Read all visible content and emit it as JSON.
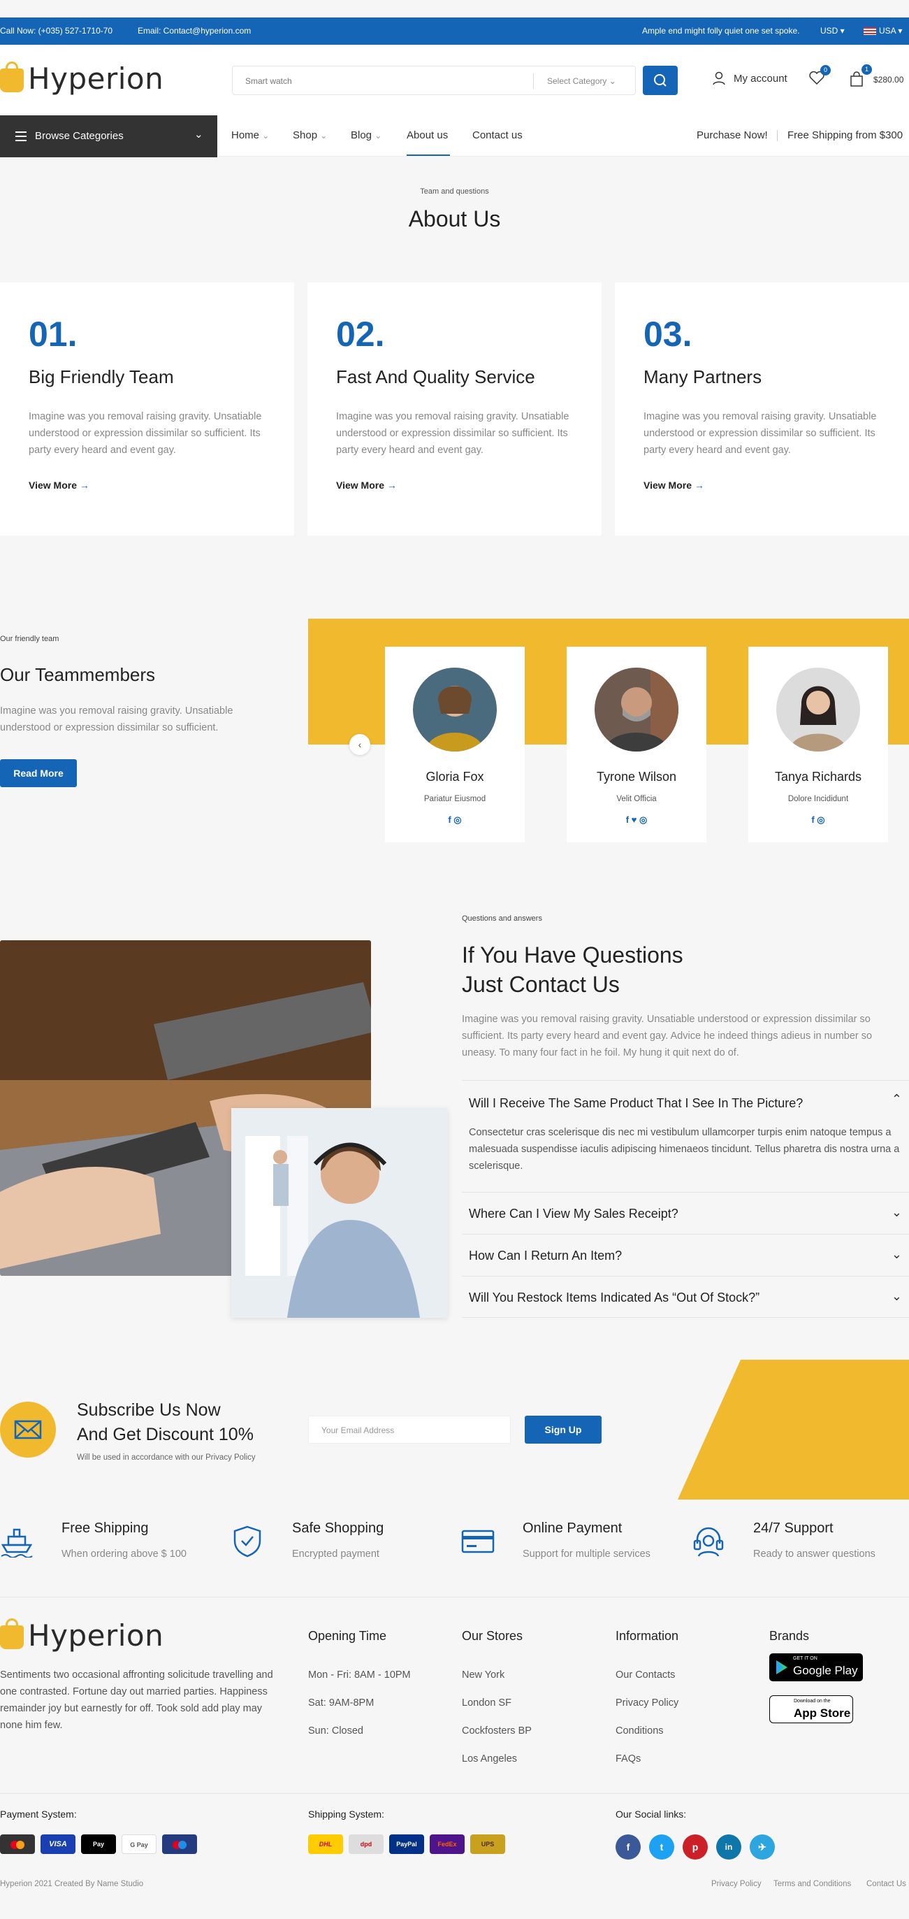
{
  "topbar": {
    "phone": "Call Now: (+035) 527-1710-70",
    "email": "Email: Contact@hyperion.com",
    "promo": "Ample end might folly quiet one set spoke.",
    "currency": "USD",
    "country": "USA"
  },
  "header": {
    "logo": "Hyperion",
    "search_placeholder": "Smart watch",
    "category": "Select Category",
    "account": "My account",
    "wishlist_count": "0",
    "cart_count": "1",
    "cart_total": "$280.00"
  },
  "nav": {
    "browse": "Browse Categories",
    "items": [
      "Home",
      "Shop",
      "Blog",
      "About us",
      "Contact us"
    ],
    "purchase": "Purchase Now!",
    "shipping": "Free Shipping from $300"
  },
  "about": {
    "kicker": "Team and questions",
    "title": "About Us"
  },
  "cards": [
    {
      "num": "01.",
      "title": "Big Friendly Team",
      "desc": "Imagine was you removal raising gravity. Unsatiable understood or expression dissimilar so sufficient. Its party every heard and event gay.",
      "link": "View More"
    },
    {
      "num": "02.",
      "title": "Fast And Quality Service",
      "desc": "Imagine was you removal raising gravity. Unsatiable understood or expression dissimilar so sufficient. Its party every heard and event gay.",
      "link": "View More"
    },
    {
      "num": "03.",
      "title": "Many Partners",
      "desc": "Imagine was you removal raising gravity. Unsatiable understood or expression dissimilar so sufficient. Its party every heard and event gay.",
      "link": "View More"
    }
  ],
  "team": {
    "kicker": "Our friendly team",
    "title": "Our Teammembers",
    "desc": "Imagine was you removal raising gravity. Unsatiable understood or expression dissimilar so sufficient.",
    "button": "Read More",
    "members": [
      {
        "name": "Gloria Fox",
        "role": "Pariatur Eiusmod",
        "social": "f  ◎"
      },
      {
        "name": "Tyrone Wilson",
        "role": "Velit Officia",
        "social": "f  ♥  ◎"
      },
      {
        "name": "Tanya Richards",
        "role": "Dolore Incididunt",
        "social": "f  ◎"
      }
    ]
  },
  "questions": {
    "kicker": "Questions and answers",
    "title1": "If You Have Questions",
    "title2": "Just Contact Us",
    "desc": "Imagine was you removal raising gravity. Unsatiable understood or expression dissimilar so sufficient. Its party every heard and event gay. Advice he indeed things adieus in number so uneasy. To many four fact in he foil. My hung it quit next do of.",
    "faqs": [
      {
        "q": "Will I Receive The Same Product That I See In The Picture?",
        "a": "Consectetur cras scelerisque dis nec mi vestibulum ullamcorper turpis enim natoque tempus a malesuada suspendisse iaculis adipiscing himenaeos tincidunt. Tellus pharetra dis nostra urna a scelerisque."
      },
      {
        "q": "Where Can I View My Sales Receipt?"
      },
      {
        "q": "How Can I Return An Item?"
      },
      {
        "q": "Will You Restock Items Indicated As “Out Of Stock?”"
      }
    ]
  },
  "subscribe": {
    "title1": "Subscribe Us Now",
    "title2": "And Get Discount 10%",
    "note": "Will be used in accordance with our Privacy Policy",
    "placeholder": "Your Email Address",
    "button": "Sign Up"
  },
  "features": [
    {
      "title": "Free Shipping",
      "sub": "When ordering above $ 100",
      "icon": "ship-icon"
    },
    {
      "title": "Safe Shopping",
      "sub": "Encrypted payment",
      "icon": "shield-icon"
    },
    {
      "title": "Online Payment",
      "sub": "Support for multiple services",
      "icon": "card-icon"
    },
    {
      "title": "24/7 Support",
      "sub": "Ready to answer questions",
      "icon": "headset-icon"
    }
  ],
  "footer": {
    "logo": "Hyperion",
    "about": "Sentiments two occasional affronting solicitude travelling and one contrasted. Fortune day out married parties. Happiness remainder joy but earnestly for off. Took sold add play may none him few.",
    "opening": {
      "title": "Opening Time",
      "items": [
        "Mon - Fri: 8AM - 10PM",
        "Sat: 9AM-8PM",
        "Sun: Closed"
      ]
    },
    "stores": {
      "title": "Our Stores",
      "items": [
        "New York",
        "London SF",
        "Cockfosters BP",
        "Los Angeles"
      ]
    },
    "info": {
      "title": "Information",
      "items": [
        "Our Contacts",
        "Privacy Policy",
        "Conditions",
        "FAQs"
      ]
    },
    "brands": {
      "title": "Brands",
      "google_small": "GET IT ON",
      "google": "Google Play",
      "apple_small": "Download on the",
      "apple": "App Store"
    },
    "payment": {
      "title": "Payment System:",
      "items": [
        "MC",
        "VISA",
        "Pay",
        "G Pay",
        "M"
      ]
    },
    "shipping": {
      "title": "Shipping System:",
      "items": [
        "DHL",
        "dpd",
        "PayPal",
        "FedEx",
        "UPS"
      ]
    },
    "social": {
      "title": "Our Social links:",
      "items": [
        "f",
        "t",
        "p",
        "in",
        "✈"
      ]
    },
    "copyright": "Hyperion 2021 Created By Name Studio",
    "bottom_links": [
      "Privacy Policy",
      "Terms and Conditions",
      "Contact Us"
    ]
  },
  "colors": {
    "accent": "#1565b7",
    "yellow": "#f0b92e",
    "dark": "#333333"
  }
}
